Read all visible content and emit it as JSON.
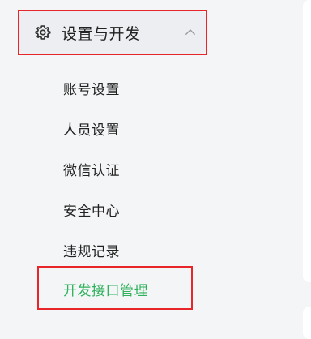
{
  "sidebar": {
    "group": {
      "label": "设置与开发",
      "icon": "gear-icon",
      "chevron": "chevron-up-icon"
    },
    "items": [
      {
        "label": "账号设置"
      },
      {
        "label": "人员设置"
      },
      {
        "label": "微信认证"
      },
      {
        "label": "安全中心"
      },
      {
        "label": "违规记录"
      },
      {
        "label": "开发接口管理",
        "active": true
      }
    ]
  },
  "colors": {
    "active_text": "#2db15a",
    "highlight_border": "#e8262a",
    "background": "#f4f5f7"
  }
}
